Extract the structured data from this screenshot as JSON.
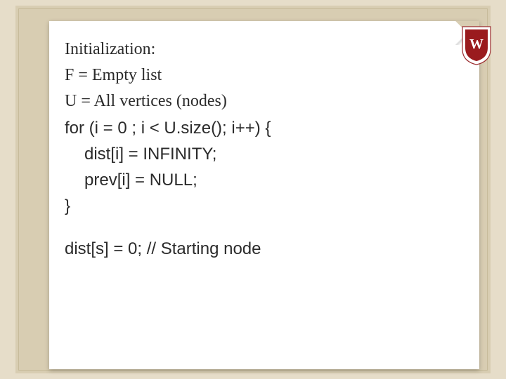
{
  "slide": {
    "lines": {
      "l1": "Initialization:",
      "l2": "F = Empty list",
      "l3": "U = All vertices (nodes)",
      "l4": "for (i = 0 ; i < U.size(); i++) {",
      "l5": "dist[i] = INFINITY;",
      "l6": "prev[i] = NULL;",
      "l7": "}",
      "l8": "dist[s] = 0; // Starting node"
    }
  },
  "icons": {
    "crest": "uw-crest-icon"
  },
  "colors": {
    "page_bg": "#e6ddc9",
    "frame_bg": "#d8cdb2",
    "card_bg": "#ffffff",
    "crest_red": "#9a1b1e",
    "text": "#2b2b2b"
  }
}
